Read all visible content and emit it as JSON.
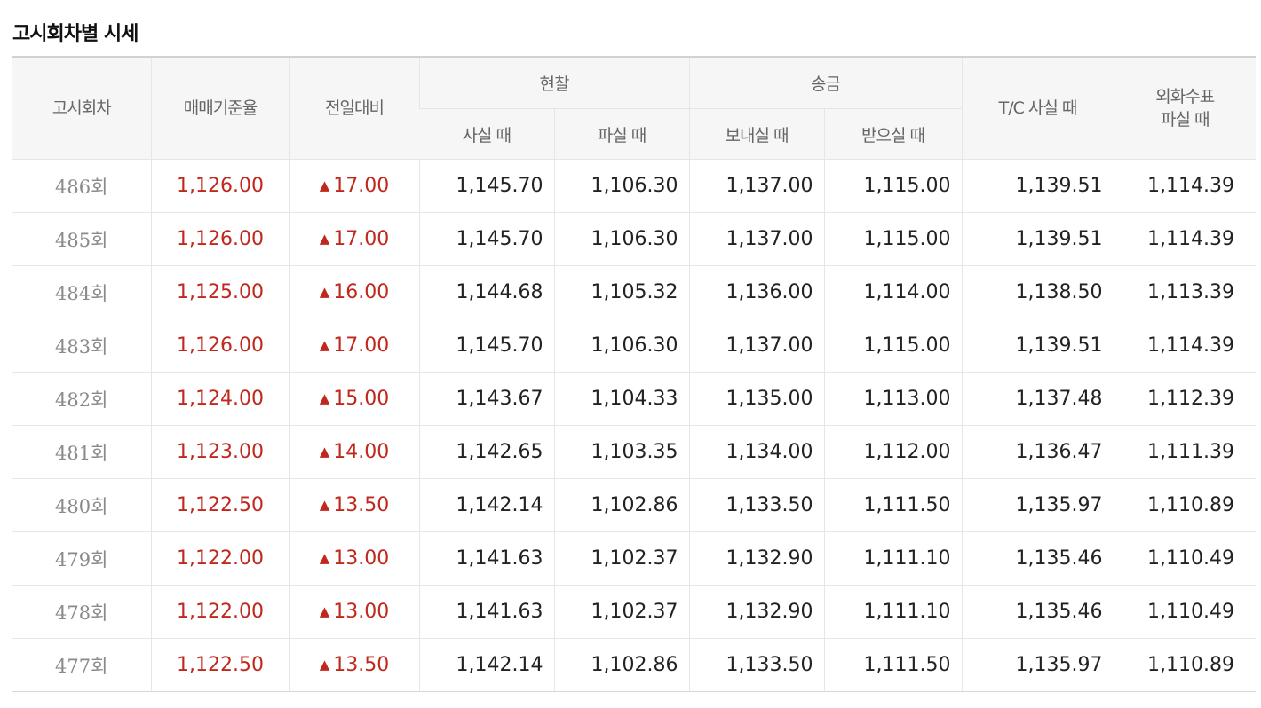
{
  "title": "고시회차별 시세",
  "headers": {
    "round": "고시회차",
    "base_rate": "매매기준율",
    "change": "전일대비",
    "cash": "현찰",
    "cash_buy": "사실 때",
    "cash_sell": "파실 때",
    "remit": "송금",
    "remit_send": "보내실 때",
    "remit_receive": "받으실 때",
    "tc_buy": "T/C 사실 때",
    "foreign_check_line1": "외화수표",
    "foreign_check_line2": "파실 때"
  },
  "change_icon": "up-triangle-icon",
  "change_icon_glyph": "▲",
  "rows": [
    {
      "round": "486회",
      "base": "1,126.00",
      "change": "17.00",
      "cash_buy": "1,145.70",
      "cash_sell": "1,106.30",
      "send": "1,137.00",
      "receive": "1,115.00",
      "tc": "1,139.51",
      "check": "1,114.39"
    },
    {
      "round": "485회",
      "base": "1,126.00",
      "change": "17.00",
      "cash_buy": "1,145.70",
      "cash_sell": "1,106.30",
      "send": "1,137.00",
      "receive": "1,115.00",
      "tc": "1,139.51",
      "check": "1,114.39"
    },
    {
      "round": "484회",
      "base": "1,125.00",
      "change": "16.00",
      "cash_buy": "1,144.68",
      "cash_sell": "1,105.32",
      "send": "1,136.00",
      "receive": "1,114.00",
      "tc": "1,138.50",
      "check": "1,113.39"
    },
    {
      "round": "483회",
      "base": "1,126.00",
      "change": "17.00",
      "cash_buy": "1,145.70",
      "cash_sell": "1,106.30",
      "send": "1,137.00",
      "receive": "1,115.00",
      "tc": "1,139.51",
      "check": "1,114.39"
    },
    {
      "round": "482회",
      "base": "1,124.00",
      "change": "15.00",
      "cash_buy": "1,143.67",
      "cash_sell": "1,104.33",
      "send": "1,135.00",
      "receive": "1,113.00",
      "tc": "1,137.48",
      "check": "1,112.39"
    },
    {
      "round": "481회",
      "base": "1,123.00",
      "change": "14.00",
      "cash_buy": "1,142.65",
      "cash_sell": "1,103.35",
      "send": "1,134.00",
      "receive": "1,112.00",
      "tc": "1,136.47",
      "check": "1,111.39"
    },
    {
      "round": "480회",
      "base": "1,122.50",
      "change": "13.50",
      "cash_buy": "1,142.14",
      "cash_sell": "1,102.86",
      "send": "1,133.50",
      "receive": "1,111.50",
      "tc": "1,135.97",
      "check": "1,110.89"
    },
    {
      "round": "479회",
      "base": "1,122.00",
      "change": "13.00",
      "cash_buy": "1,141.63",
      "cash_sell": "1,102.37",
      "send": "1,132.90",
      "receive": "1,111.10",
      "tc": "1,135.46",
      "check": "1,110.49"
    },
    {
      "round": "478회",
      "base": "1,122.00",
      "change": "13.00",
      "cash_buy": "1,141.63",
      "cash_sell": "1,102.37",
      "send": "1,132.90",
      "receive": "1,111.10",
      "tc": "1,135.46",
      "check": "1,110.49"
    },
    {
      "round": "477회",
      "base": "1,122.50",
      "change": "13.50",
      "cash_buy": "1,142.14",
      "cash_sell": "1,102.86",
      "send": "1,133.50",
      "receive": "1,111.50",
      "tc": "1,135.97",
      "check": "1,110.89"
    }
  ]
}
